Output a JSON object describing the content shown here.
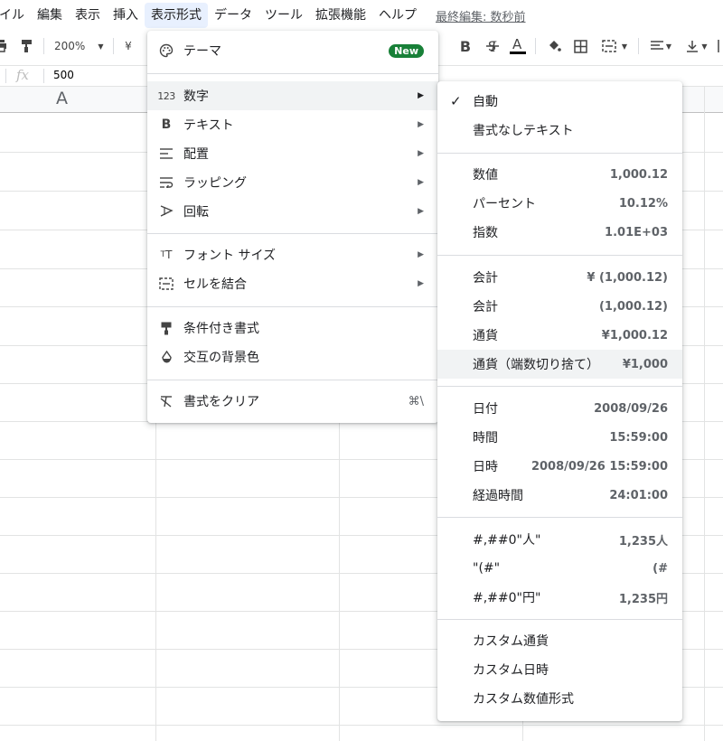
{
  "menubar": {
    "items": [
      "イル",
      "編集",
      "表示",
      "挿入",
      "表示形式",
      "データ",
      "ツール",
      "拡張機能",
      "ヘルプ"
    ],
    "last_edit": "最終編集: 数秒前"
  },
  "toolbar": {
    "zoom": "200%",
    "currency": "¥"
  },
  "formula": {
    "fx": "fx",
    "value": "500"
  },
  "sheet": {
    "column_letter": "A"
  },
  "format_menu": {
    "theme": "テーマ",
    "new_badge": "New",
    "number": "数字",
    "text": "テキスト",
    "align": "配置",
    "wrap": "ラッピング",
    "rotate": "回転",
    "font_size": "フォント サイズ",
    "merge": "セルを結合",
    "conditional": "条件付き書式",
    "alternating": "交互の背景色",
    "clear": "書式をクリア",
    "clear_shortcut": "⌘\\"
  },
  "number_menu": {
    "auto": "自動",
    "plain": "書式なしテキスト",
    "number": {
      "label": "数値",
      "example": "1,000.12"
    },
    "percent": {
      "label": "パーセント",
      "example": "10.12%"
    },
    "scientific": {
      "label": "指数",
      "example": "1.01E+03"
    },
    "accounting1": {
      "label": "会計",
      "example": "¥ (1,000.12)"
    },
    "accounting2": {
      "label": "会計",
      "example": "(1,000.12)"
    },
    "currency": {
      "label": "通貨",
      "example": "¥1,000.12"
    },
    "currency_round": {
      "label": "通貨（端数切り捨て）",
      "example": "¥1,000"
    },
    "date": {
      "label": "日付",
      "example": "2008/09/26"
    },
    "time": {
      "label": "時間",
      "example": "15:59:00"
    },
    "datetime": {
      "label": "日時",
      "example": "2008/09/26 15:59:00"
    },
    "duration": {
      "label": "経過時間",
      "example": "24:01:00"
    },
    "custom1": {
      "label": "#,##0\"人\"",
      "example": "1,235人"
    },
    "custom2": {
      "label": "\"(#\"",
      "example": "(#"
    },
    "custom3": {
      "label": "#,##0\"円\"",
      "example": "1,235円"
    },
    "custom_currency": "カスタム通貨",
    "custom_datetime": "カスタム日時",
    "custom_number": "カスタム数値形式"
  }
}
